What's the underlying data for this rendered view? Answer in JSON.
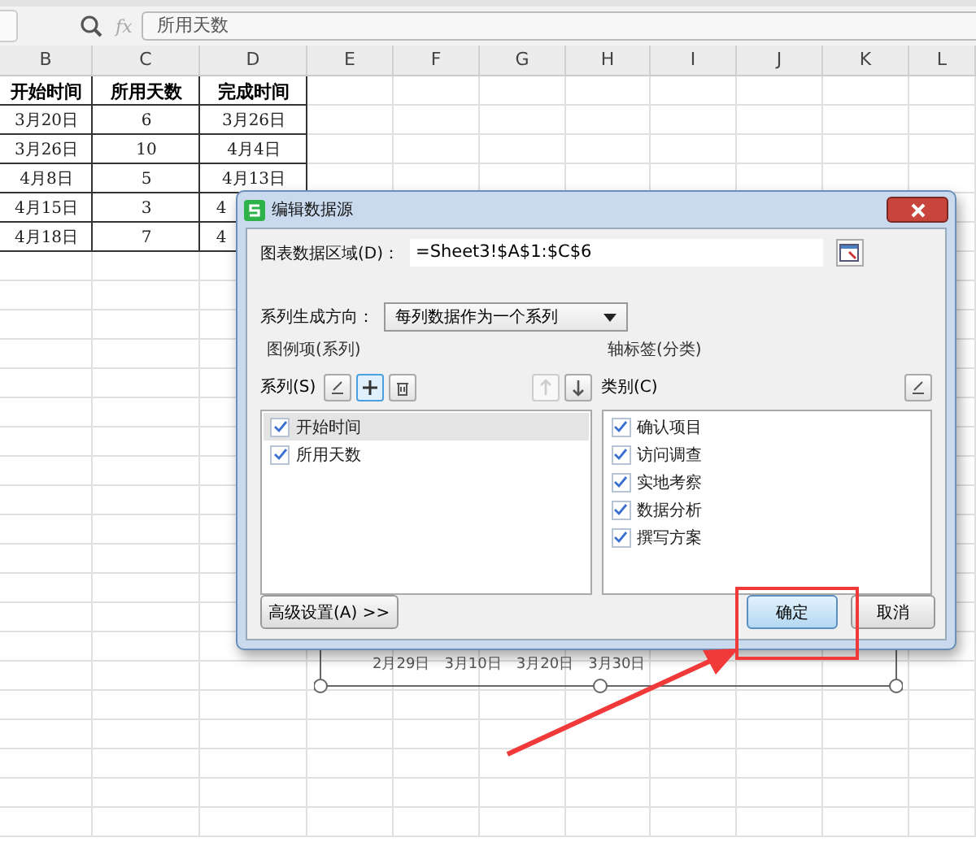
{
  "formula_bar": {
    "fx": "fx",
    "value": "所用天数"
  },
  "columns": [
    "B",
    "C",
    "D",
    "E",
    "F",
    "G",
    "H",
    "I",
    "J",
    "K",
    "L"
  ],
  "table": {
    "header": [
      "开始时间",
      "所用天数",
      "完成时间"
    ],
    "rows": [
      {
        "cells": [
          "3月20日",
          "6",
          "3月26日"
        ],
        "cut": false
      },
      {
        "cells": [
          "3月26日",
          "10",
          "4月4日"
        ],
        "cut": false
      },
      {
        "cells": [
          "4月8日",
          "5",
          "4月13日"
        ],
        "cut": false
      },
      {
        "cells": [
          "4月15日",
          "3",
          "4"
        ],
        "cut": true
      },
      {
        "cells": [
          "4月18日",
          "7",
          "4"
        ],
        "cut": true
      }
    ]
  },
  "chart": {
    "axis_labels": [
      "2月29日",
      "3月10日",
      "3月20日",
      "3月30日"
    ]
  },
  "dialog": {
    "title": "编辑数据源",
    "range_label": "图表数据区域(D)：",
    "range_value": "=Sheet3!$A$1:$C$6",
    "direction_label": "系列生成方向：",
    "direction_value": "每列数据作为一个系列",
    "legend_group": "图例项(系列)",
    "axis_group": "轴标签(分类)",
    "series_label": "系列(S)",
    "category_label": "类别(C)",
    "series_tools": [
      {
        "kind": "edit",
        "disabled": false,
        "selected": false
      },
      {
        "kind": "add",
        "disabled": false,
        "selected": true
      },
      {
        "kind": "delete",
        "disabled": false,
        "selected": false
      },
      {
        "kind": "up",
        "disabled": true,
        "selected": false
      },
      {
        "kind": "down",
        "disabled": false,
        "selected": false
      }
    ],
    "series": [
      {
        "label": "开始时间",
        "checked": true,
        "selected": true
      },
      {
        "label": "所用天数",
        "checked": true,
        "selected": false
      }
    ],
    "categories": [
      {
        "label": "确认项目",
        "checked": true
      },
      {
        "label": "访问调查",
        "checked": true
      },
      {
        "label": "实地考察",
        "checked": true
      },
      {
        "label": "数据分析",
        "checked": true
      },
      {
        "label": "撰写方案",
        "checked": true
      }
    ],
    "advanced_button": "高级设置(A) >>",
    "ok_button": "确定",
    "cancel_button": "取消"
  }
}
